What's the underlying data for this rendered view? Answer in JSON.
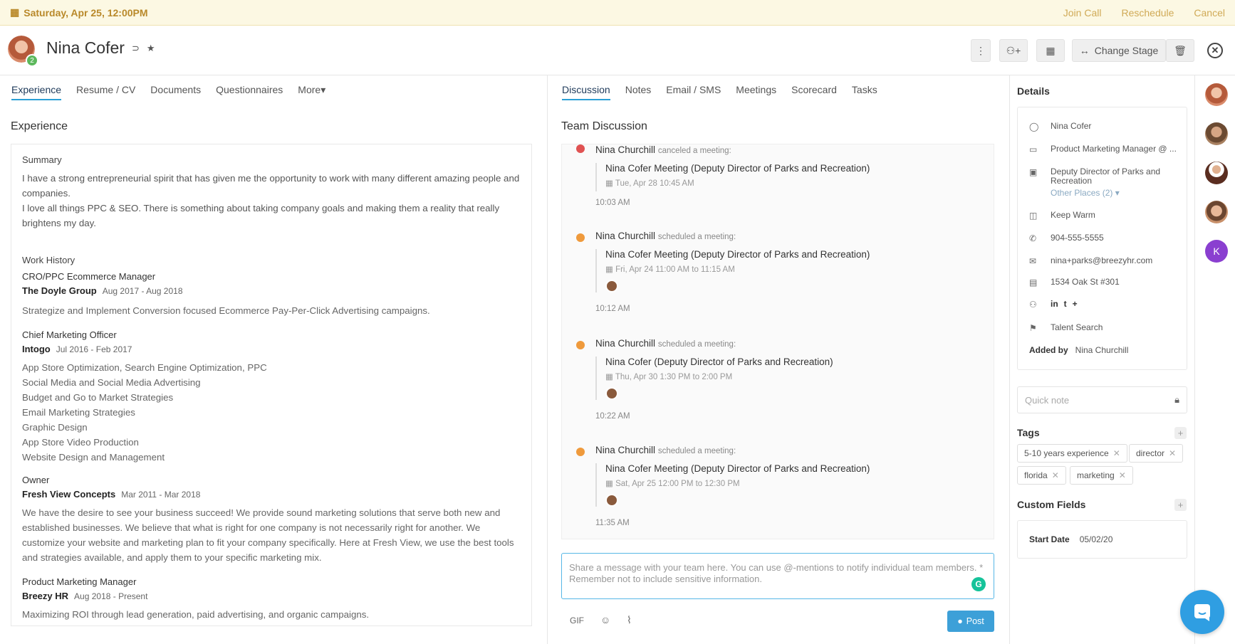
{
  "banner": {
    "date": "Saturday, Apr 25, 12:00PM",
    "join": "Join Call",
    "reschedule": "Reschedule",
    "cancel": "Cancel"
  },
  "candidate": {
    "name": "Nina Cofer",
    "badge": "2"
  },
  "header_actions": {
    "change_stage": "Change Stage"
  },
  "left_tabs": [
    "Experience",
    "Resume / CV",
    "Documents",
    "Questionnaires",
    "More"
  ],
  "experience": {
    "title": "Experience",
    "summary_label": "Summary",
    "summary_1": "I have a strong entrepreneurial spirit that has given me the opportunity to work with many different amazing people and companies.",
    "summary_2": "I love all things PPC & SEO. There is something about taking company goals and making them a reality that really brightens my day.",
    "work_history_label": "Work History",
    "jobs": [
      {
        "title": "CRO/PPC Ecommerce Manager",
        "company": "The Doyle Group",
        "dates": "Aug 2017 - Aug 2018",
        "desc": "Strategize and Implement Conversion focused Ecommerce Pay-Per-Click Advertising campaigns."
      },
      {
        "title": "Chief Marketing Officer",
        "company": "Intogo",
        "dates": "Jul 2016 - Feb 2017",
        "desc_lines": [
          "App Store Optimization, Search Engine Optimization, PPC",
          "Social Media and Social Media Advertising",
          "Budget and Go to Market Strategies",
          "Email Marketing Strategies",
          "Graphic Design",
          "App Store Video Production",
          "Website Design and Management"
        ]
      },
      {
        "title": "Owner",
        "company": "Fresh View Concepts",
        "dates": "Mar 2011 - Mar 2018",
        "desc": "We have the desire to see your business succeed! We provide sound marketing solutions that serve both new and established businesses. We believe that what is right for one company is not necessarily right for another. We customize your website and marketing plan to fit your company specifically. Here at Fresh View, we use the best tools and strategies available, and apply them to your specific marketing mix."
      },
      {
        "title": "Product Marketing Manager",
        "company": "Breezy HR",
        "dates": "Aug 2018 - Present",
        "desc": "Maximizing ROI through lead generation, paid advertising, and organic campaigns."
      }
    ]
  },
  "right_tabs": [
    "Discussion",
    "Notes",
    "Email / SMS",
    "Meetings",
    "Scorecard",
    "Tasks"
  ],
  "discussion": {
    "title": "Team Discussion",
    "entries": [
      {
        "who": "Nina Churchill",
        "action": "canceled a meeting:",
        "meeting": "Nina Cofer Meeting (Deputy Director of Parks and Recreation)",
        "when": "Tue, Apr 28 10:45 AM",
        "time": "10:03 AM",
        "color": "#e05252"
      },
      {
        "who": "Nina Churchill",
        "action": "scheduled a meeting:",
        "meeting": "Nina Cofer Meeting (Deputy Director of Parks and Recreation)",
        "when": "Fri, Apr 24 11:00 AM to 11:15 AM",
        "time": "10:12 AM",
        "color": "#ef9a3c"
      },
      {
        "who": "Nina Churchill",
        "action": "scheduled a meeting:",
        "meeting": "Nina Cofer (Deputy Director of Parks and Recreation)",
        "when": "Thu, Apr 30 1:30 PM to 2:00 PM",
        "time": "10:22 AM",
        "color": "#ef9a3c"
      },
      {
        "who": "Nina Churchill",
        "action": "scheduled a meeting:",
        "meeting": "Nina Cofer Meeting (Deputy Director of Parks and Recreation)",
        "when": "Sat, Apr 25 12:00 PM to 12:30 PM",
        "time": "11:35 AM",
        "color": "#ef9a3c"
      }
    ],
    "placeholder": "Share a message with your team here. You can use @-mentions to notify individual team members. * Remember not to include sensitive information.",
    "gif": "GIF",
    "post": "Post"
  },
  "details": {
    "title": "Details",
    "name": "Nina Cofer",
    "headline": "Product Marketing Manager @ ...",
    "position": "Deputy Director of Parks and Recreation",
    "other_places": "Other Places (2)",
    "stage": "Keep Warm",
    "phone": "904-555-5555",
    "email": "nina+parks@breezyhr.com",
    "address": "1534 Oak St #301",
    "source": "Talent Search",
    "added_by_label": "Added by",
    "added_by": "Nina Churchill"
  },
  "quick_note": "Quick note",
  "tags": {
    "title": "Tags",
    "items": [
      "5-10 years experience",
      "director",
      "florida",
      "marketing"
    ]
  },
  "custom_fields": {
    "title": "Custom Fields",
    "label": "Start Date",
    "value": "05/02/20"
  },
  "rail": {
    "k": "K"
  }
}
